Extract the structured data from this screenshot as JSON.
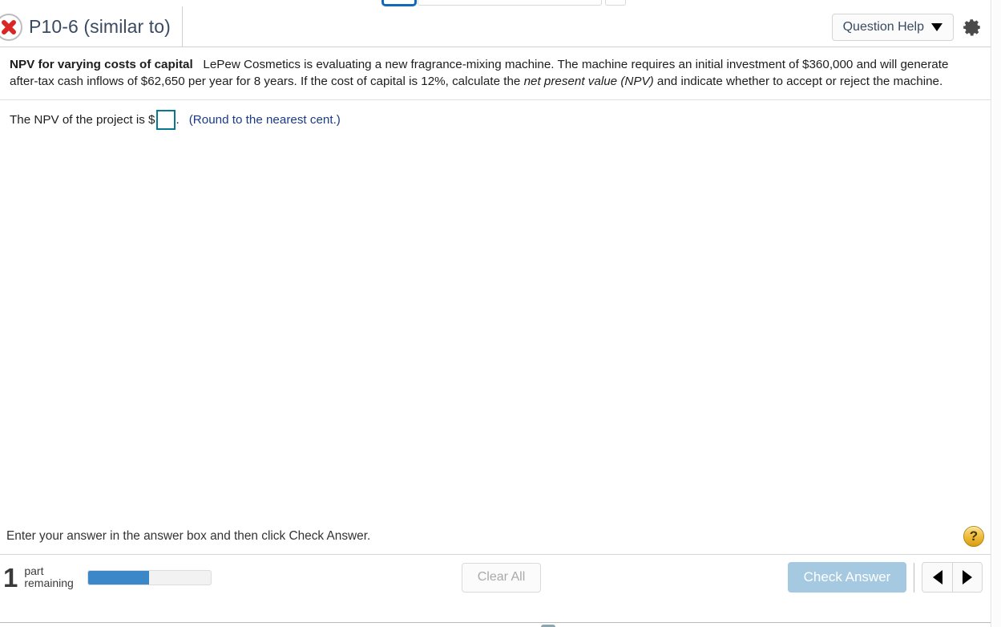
{
  "header": {
    "status_icon": "red-x-icon",
    "title": "P10-6 (similar to)",
    "question_help_label": "Question Help",
    "caret_icon": "chevron-down-icon",
    "gear_icon": "gear-icon"
  },
  "question": {
    "bold_lead": "NPV for varying costs of capital",
    "part1": "LePew Cosmetics is evaluating a new fragrance-mixing machine.  The machine requires an initial investment of $360,000 and will generate after-tax cash inflows of $62,650 per year for 8 years.  If the cost of capital is 12%, calculate the ",
    "italic": "net present value (NPV)",
    "part2": " and indicate whether to accept or reject the machine."
  },
  "answer": {
    "prompt": "The NPV of the project is $",
    "input_value": "",
    "input_placeholder": "",
    "period": ".",
    "rounding_note": "(Round to the nearest cent.)",
    "input_border_color": "#07798f"
  },
  "instruction": {
    "text": "Enter your answer in the answer box and then click Check Answer.",
    "help_bubble_glyph": "?"
  },
  "footer": {
    "parts_count": "1",
    "parts_label_line1": "part",
    "parts_label_line2": "remaining",
    "progress_percent": 50,
    "progress_fill_color": "#3c87c8",
    "clear_all_label": "Clear All",
    "check_answer_label": "Check Answer",
    "check_answer_color": "#a5c9e0",
    "prev_icon": "triangle-left-icon",
    "next_icon": "triangle-right-icon"
  }
}
